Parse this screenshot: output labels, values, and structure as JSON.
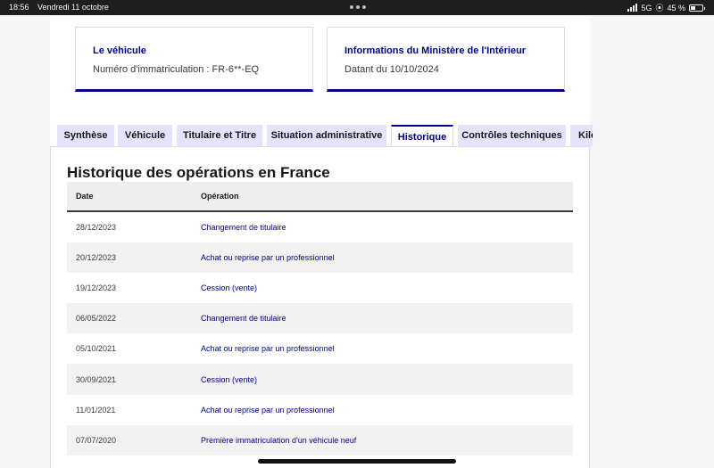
{
  "status_bar": {
    "time": "18:56",
    "date": "Vendredi 11 octobre",
    "network": "5G",
    "battery": "45 %",
    "battery_level": 0.45
  },
  "cards": [
    {
      "title": "Le véhicule",
      "text": "Numéro d'immatriculation : FR-6**-EQ"
    },
    {
      "title": "Informations du Ministère de l'Intérieur",
      "text": "Datant du 10/10/2024"
    }
  ],
  "tabs": [
    {
      "label": "Synthèse",
      "active": false
    },
    {
      "label": "Véhicule",
      "active": false
    },
    {
      "label": "Titulaire et Titre",
      "active": false
    },
    {
      "label": "Situation administrative",
      "active": false
    },
    {
      "label": "Historique",
      "active": true
    },
    {
      "label": "Contrôles techniques",
      "active": false
    },
    {
      "label": "Kilo",
      "active": false
    }
  ],
  "history": {
    "title": "Historique des opérations en France",
    "columns": {
      "date": "Date",
      "operation": "Opération"
    },
    "rows": [
      {
        "date": "28/12/2023",
        "operation": "Changement de titulaire"
      },
      {
        "date": "20/12/2023",
        "operation": "Achat ou reprise par un professionnel"
      },
      {
        "date": "19/12/2023",
        "operation": "Cession (vente)"
      },
      {
        "date": "06/05/2022",
        "operation": "Changement de titulaire"
      },
      {
        "date": "05/10/2021",
        "operation": "Achat ou reprise par un professionnel"
      },
      {
        "date": "30/09/2021",
        "operation": "Cession (vente)"
      },
      {
        "date": "11/01/2021",
        "operation": "Achat ou reprise par un professionnel"
      },
      {
        "date": "07/07/2020",
        "operation": "Première immatriculation d'un véhicule neuf"
      }
    ]
  },
  "colors": {
    "accent": "#000091",
    "tab_background": "#e3e3fd",
    "stripe": "#f2f2f2"
  }
}
